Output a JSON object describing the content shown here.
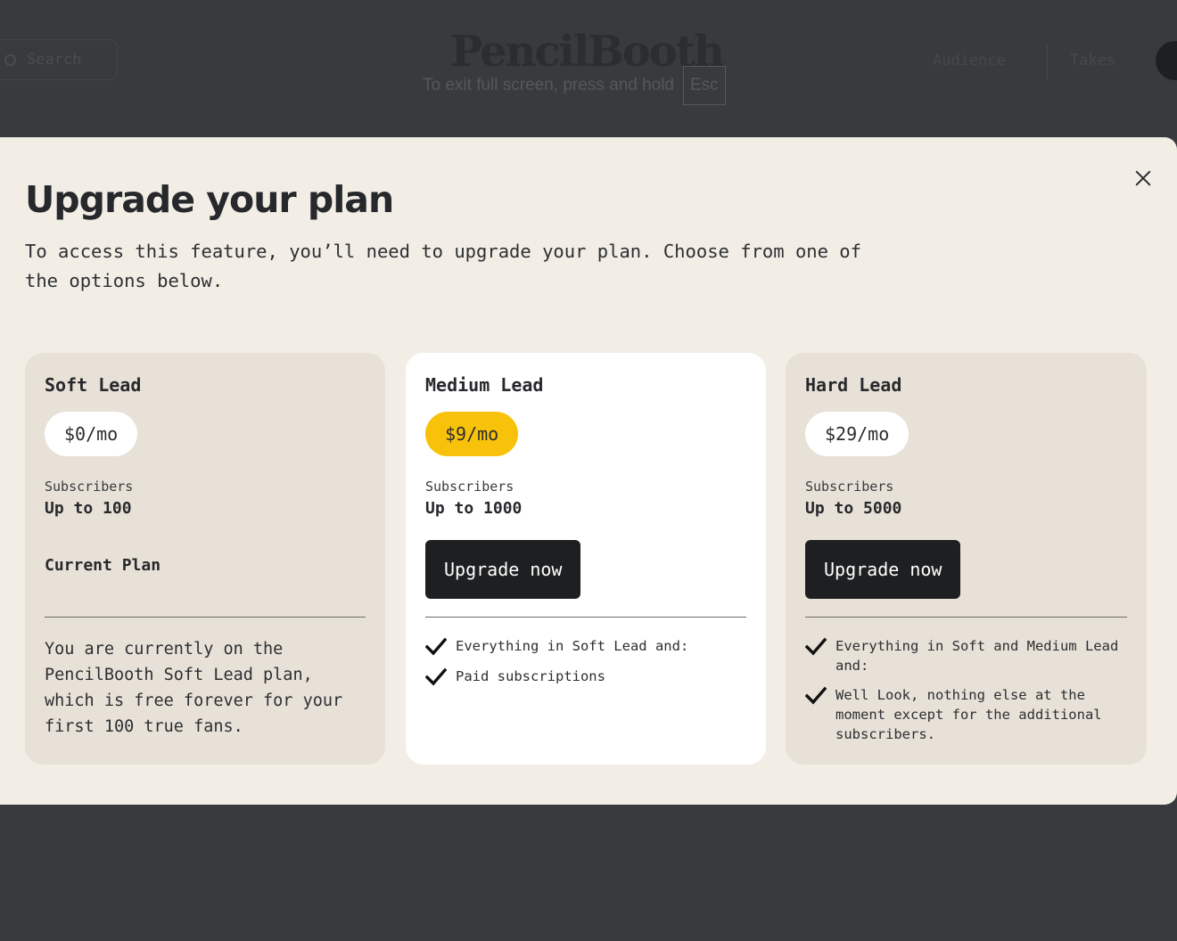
{
  "background": {
    "search_placeholder": "Search",
    "logo_text": "PencilBooth",
    "nav": [
      "Audience",
      "Takes"
    ],
    "fullscreen_notice": "To exit full screen, press and hold",
    "fullscreen_key": "Esc"
  },
  "modal": {
    "title": "Upgrade your plan",
    "description": "To access this feature, you’ll need to upgrade your plan. Choose from one of the options below."
  },
  "plans": [
    {
      "name": "Soft Lead",
      "price": "$0/mo",
      "subscribers_label": "Subscribers",
      "subscribers_value": "Up to 100",
      "status": "Current Plan",
      "body": "You are currently on the PencilBooth Soft Lead plan, which is free forever for your first 100 true fans."
    },
    {
      "name": "Medium Lead",
      "price": "$9/mo",
      "subscribers_label": "Subscribers",
      "subscribers_value": "Up to 1000",
      "button": "Upgrade now",
      "features": [
        "Everything in Soft Lead and:",
        "Paid subscriptions"
      ]
    },
    {
      "name": "Hard Lead",
      "price": "$29/mo",
      "subscribers_label": "Subscribers",
      "subscribers_value": "Up to 5000",
      "button": "Upgrade now",
      "features": [
        "Everything in Soft and Medium Lead and:",
        "Well Look, nothing else at the moment except for the additional subscribers."
      ]
    }
  ],
  "colors": {
    "accent": "#f9c20a",
    "modal_bg": "#f2eee6",
    "card_bg": "#e7e1d7",
    "button_bg": "#1e1f21"
  },
  "icons": {
    "close": "close-icon",
    "check": "check-icon",
    "search": "search-icon"
  }
}
